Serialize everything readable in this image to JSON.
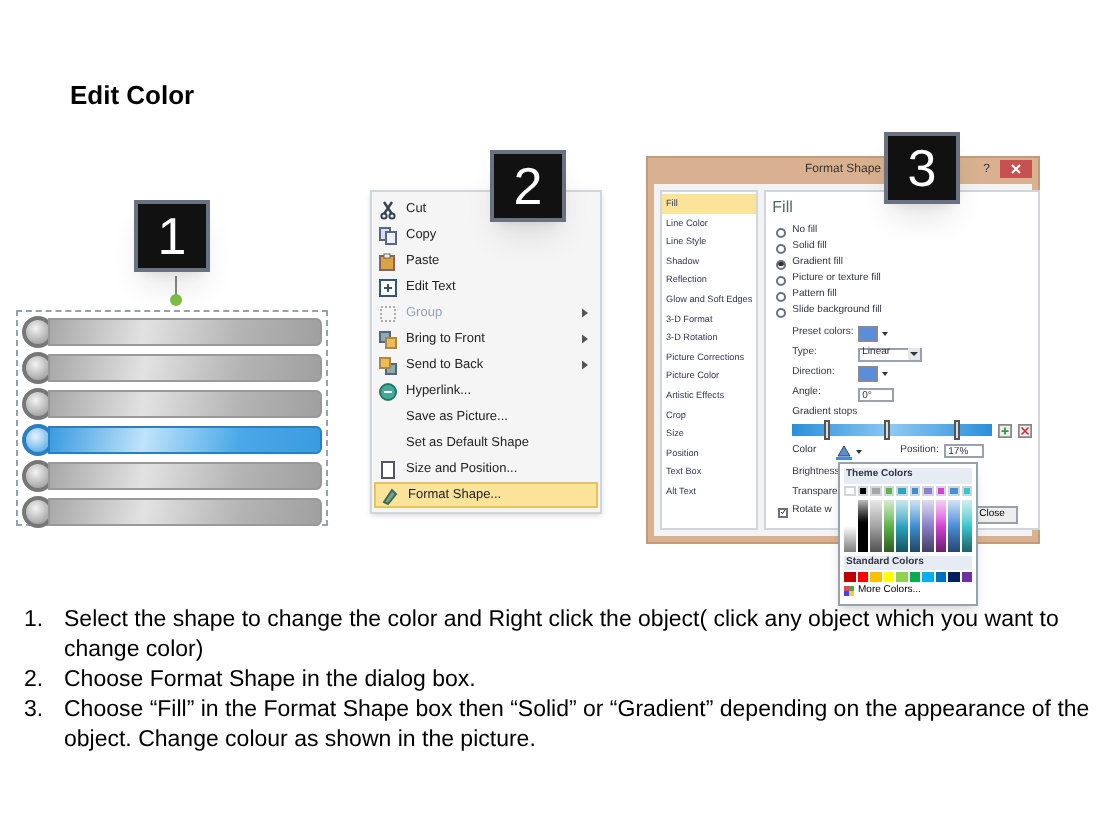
{
  "title": "Edit Color",
  "badges": [
    "1",
    "2",
    "3"
  ],
  "shapes": {
    "bars": [
      {
        "selected": false
      },
      {
        "selected": false
      },
      {
        "selected": false
      },
      {
        "selected": true
      },
      {
        "selected": false
      },
      {
        "selected": false
      }
    ]
  },
  "context_menu": {
    "items": [
      {
        "label": "Cut",
        "disabled": false,
        "submenu": false,
        "selected": false
      },
      {
        "label": "Copy",
        "disabled": false,
        "submenu": false,
        "selected": false
      },
      {
        "label": "Paste",
        "disabled": false,
        "submenu": false,
        "selected": false
      },
      {
        "label": "Edit Text",
        "disabled": false,
        "submenu": false,
        "selected": false
      },
      {
        "label": "Group",
        "disabled": true,
        "submenu": true,
        "selected": false
      },
      {
        "label": "Bring to Front",
        "disabled": false,
        "submenu": true,
        "selected": false
      },
      {
        "label": "Send to Back",
        "disabled": false,
        "submenu": true,
        "selected": false
      },
      {
        "label": "Hyperlink...",
        "disabled": false,
        "submenu": false,
        "selected": false
      },
      {
        "label": "Save as Picture...",
        "disabled": false,
        "submenu": false,
        "selected": false
      },
      {
        "label": "Set as Default Shape",
        "disabled": false,
        "submenu": false,
        "selected": false
      },
      {
        "label": "Size and Position...",
        "disabled": false,
        "submenu": false,
        "selected": false
      },
      {
        "label": "Format Shape...",
        "disabled": false,
        "submenu": false,
        "selected": true
      }
    ]
  },
  "dialog": {
    "title": "Format Shape",
    "help": "?",
    "categories": [
      {
        "label": "Fill",
        "selected": true
      },
      {
        "label": "Line Color",
        "selected": false
      },
      {
        "label": "Line Style",
        "selected": false
      },
      {
        "label": "Shadow",
        "selected": false
      },
      {
        "label": "Reflection",
        "selected": false
      },
      {
        "label": "Glow and Soft Edges",
        "selected": false
      },
      {
        "label": "3-D Format",
        "selected": false
      },
      {
        "label": "3-D Rotation",
        "selected": false
      },
      {
        "label": "Picture Corrections",
        "selected": false
      },
      {
        "label": "Picture Color",
        "selected": false
      },
      {
        "label": "Artistic Effects",
        "selected": false
      },
      {
        "label": "Crop",
        "selected": false
      },
      {
        "label": "Size",
        "selected": false
      },
      {
        "label": "Position",
        "selected": false
      },
      {
        "label": "Text Box",
        "selected": false
      },
      {
        "label": "Alt Text",
        "selected": false
      }
    ],
    "heading": "Fill",
    "fill_options": [
      {
        "label": "No fill",
        "selected": false
      },
      {
        "label": "Solid fill",
        "selected": false
      },
      {
        "label": "Gradient fill",
        "selected": true
      },
      {
        "label": "Picture or texture fill",
        "selected": false
      },
      {
        "label": "Pattern fill",
        "selected": false
      },
      {
        "label": "Slide background fill",
        "selected": false
      }
    ],
    "preset_colors_label": "Preset colors:",
    "type_label": "Type:",
    "type_value": "Linear",
    "direction_label": "Direction:",
    "angle_label": "Angle:",
    "angle_value": "0°",
    "gradient_stops_label": "Gradient stops",
    "gradient_stops": [
      {
        "level": 0.17
      },
      {
        "level": 0.47
      },
      {
        "level": 0.82
      }
    ],
    "color_label": "Color",
    "position_label": "Position:",
    "position_value": "17%",
    "brightness_label": "Brightness",
    "transparency_label": "Transpare",
    "rotate_label": "Rotate w",
    "rotate_checked": true,
    "close_button": "Close"
  },
  "palette": {
    "theme_title": "Theme Colors",
    "theme_colors": [
      {
        "color": "#ffffff"
      },
      {
        "color": "#000000"
      },
      {
        "color": "#a5a5a5"
      },
      {
        "color": "#5fb548"
      },
      {
        "color": "#2aa6c0"
      },
      {
        "color": "#3d8fd1"
      },
      {
        "color": "#8a7fc8"
      },
      {
        "color": "#d63fd6"
      },
      {
        "color": "#4b8ed8"
      },
      {
        "color": "#39c6cf"
      }
    ],
    "standard_title": "Standard Colors",
    "standard_colors": [
      {
        "color": "#c00000"
      },
      {
        "color": "#ff0000"
      },
      {
        "color": "#ffc000"
      },
      {
        "color": "#ffff00"
      },
      {
        "color": "#92d050"
      },
      {
        "color": "#00b050"
      },
      {
        "color": "#00b0f0"
      },
      {
        "color": "#0070c0"
      },
      {
        "color": "#002060"
      },
      {
        "color": "#7030a0"
      }
    ],
    "more": "More Colors..."
  },
  "instructions": [
    {
      "number": "1.",
      "text": "Select the shape to change the color and Right click the object( click any object which you want to change color)"
    },
    {
      "number": "2.",
      "text": "Choose Format Shape in the dialog box."
    },
    {
      "number": "3.",
      "text": "Choose “Fill” in the Format Shape box then “Solid” or “Gradient” depending on the appearance of the object. Change colour as shown in the picture."
    }
  ]
}
